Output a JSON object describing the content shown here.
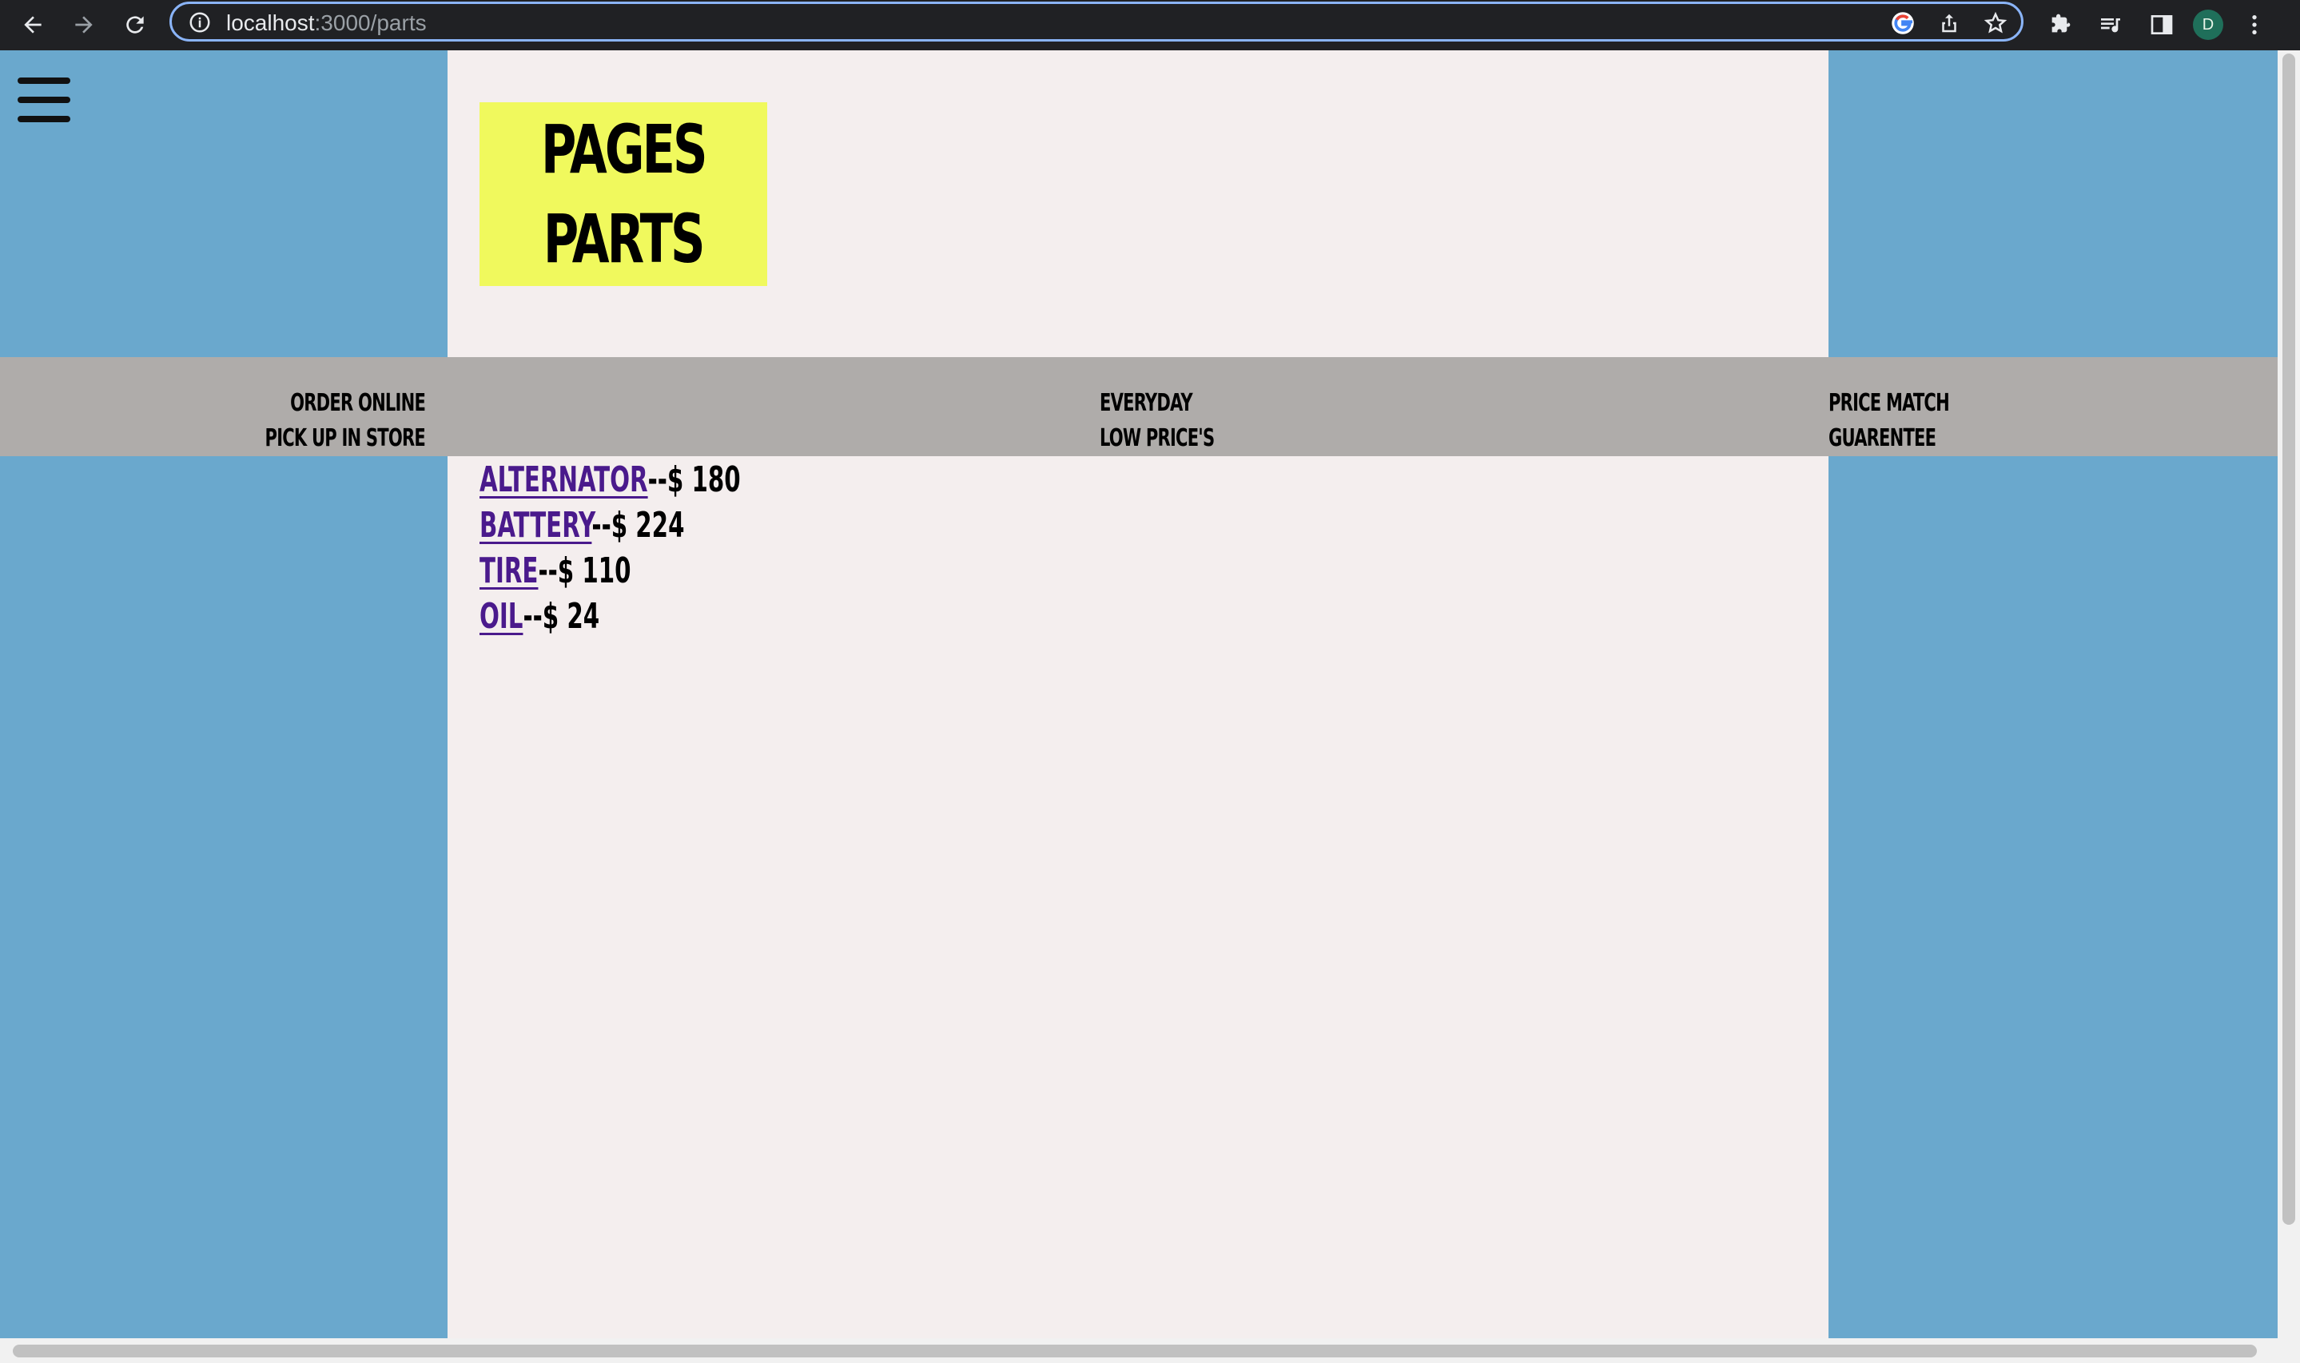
{
  "browser": {
    "url_host": "localhost",
    "url_path": ":3000/parts",
    "avatar_initial": "D",
    "icons": [
      "back-icon",
      "forward-icon",
      "reload-icon",
      "info-icon",
      "google-icon",
      "share-icon",
      "bookmark-star-icon",
      "extensions-icon",
      "media-control-icon",
      "side-panel-icon",
      "menu-dots-icon"
    ]
  },
  "header": {
    "menu_icon": "hamburger-menu-icon",
    "logo_line1": "PAGES",
    "logo_line2": "PARTS"
  },
  "banner": {
    "col1_line1": "ORDER ONLINE",
    "col1_line2": "PICK UP IN STORE",
    "col2_line1": "EVERYDAY",
    "col2_line2": "LOW PRICE'S",
    "col3_line1": "PRICE MATCH",
    "col3_line2": "GUARENTEE"
  },
  "parts": [
    {
      "name": "ALTERNATOR",
      "price": "--$ 180"
    },
    {
      "name": "BATTERY",
      "price": "--$ 224"
    },
    {
      "name": "TIRE",
      "price": "--$ 110"
    },
    {
      "name": "OIL",
      "price": "--$ 24"
    }
  ],
  "colors": {
    "side_bg": "#6aa8cd",
    "center_bg": "#f4eeee",
    "logo_bg": "#f0f95d",
    "banner_bg": "#afacaa",
    "link": "#4a1a8c"
  }
}
